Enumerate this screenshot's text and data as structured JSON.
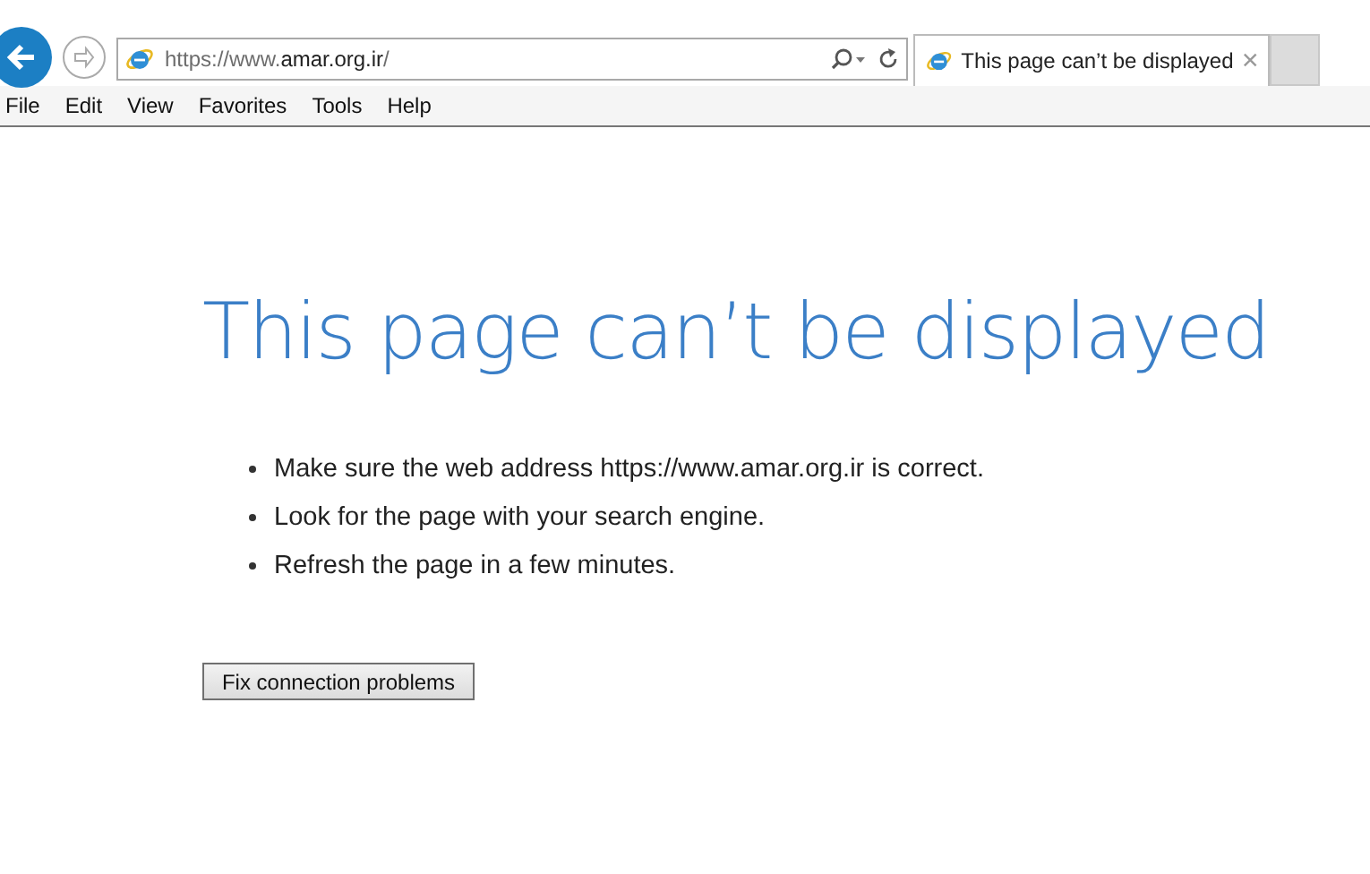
{
  "address_bar": {
    "prefix": "https://www.",
    "domain": "amar.org.ir",
    "suffix": "/"
  },
  "tabs": [
    {
      "title": "This page can’t be displayed",
      "selected": true
    }
  ],
  "menu": [
    "File",
    "Edit",
    "View",
    "Favorites",
    "Tools",
    "Help"
  ],
  "page": {
    "heading": "This page can’t be displayed",
    "tips": [
      "Make sure the web address https://www.amar.org.ir is correct.",
      "Look for the page with your search engine.",
      "Refresh the page in a few minutes."
    ],
    "button": "Fix connection problems"
  }
}
